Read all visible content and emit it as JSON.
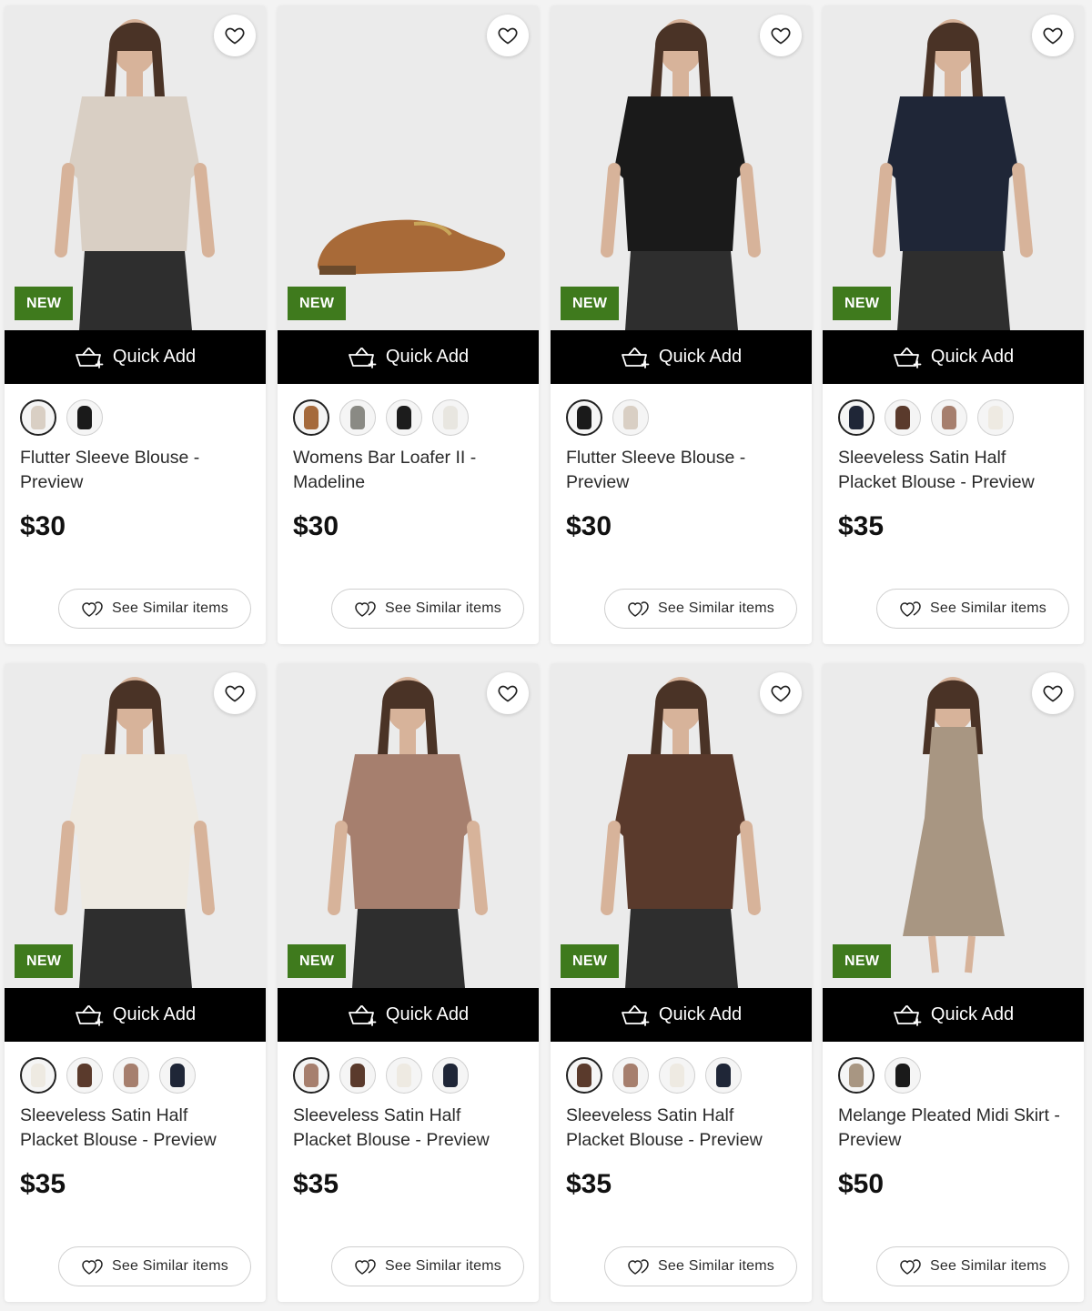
{
  "labels": {
    "new_badge": "NEW",
    "quick_add": "Quick Add",
    "see_similar": "See Similar items"
  },
  "icons": {
    "favorite": "heart-outline-icon",
    "quick_add": "basket-plus-icon",
    "similar": "double-heart-icon"
  },
  "colors": {
    "badge_bg": "#3f7a1d",
    "quick_add_bg": "#000000"
  },
  "products": [
    {
      "title": "Flutter Sleeve Blouse - Preview",
      "price": "$30",
      "badge": true,
      "product": "blouse",
      "swatches": [
        "#d9cfc4",
        "#1a1a1a"
      ]
    },
    {
      "title": "Womens Bar Loafer II - Madeline",
      "price": "$30",
      "badge": true,
      "product": "loafer",
      "swatches": [
        "#a56a3c",
        "#8a8a84",
        "#1c1c1c",
        "#e8e6e0"
      ]
    },
    {
      "title": "Flutter Sleeve Blouse - Preview",
      "price": "$30",
      "badge": true,
      "product": "blouse",
      "swatches": [
        "#1a1a1a",
        "#d9cfc4"
      ]
    },
    {
      "title": "Sleeveless Satin Half Placket Blouse - Preview",
      "price": "$35",
      "badge": true,
      "product": "top",
      "swatches": [
        "#1f2637",
        "#5a3a2c",
        "#a67f6e",
        "#eeeae2"
      ]
    },
    {
      "title": "Sleeveless Satin Half Placket Blouse - Preview",
      "price": "$35",
      "badge": true,
      "product": "top",
      "swatches": [
        "#eeeae2",
        "#5a3a2c",
        "#a67f6e",
        "#1f2637"
      ]
    },
    {
      "title": "Sleeveless Satin Half Placket Blouse - Preview",
      "price": "$35",
      "badge": true,
      "product": "top",
      "swatches": [
        "#a67f6e",
        "#5a3a2c",
        "#eeeae2",
        "#1f2637"
      ]
    },
    {
      "title": "Sleeveless Satin Half Placket Blouse - Preview",
      "price": "$35",
      "badge": true,
      "product": "top",
      "swatches": [
        "#5a3a2c",
        "#a67f6e",
        "#eeeae2",
        "#1f2637"
      ]
    },
    {
      "title": "Melange Pleated Midi Skirt - Preview",
      "price": "$50",
      "badge": true,
      "product": "skirt",
      "swatches": [
        "#a89682",
        "#1a1a1a"
      ]
    }
  ]
}
